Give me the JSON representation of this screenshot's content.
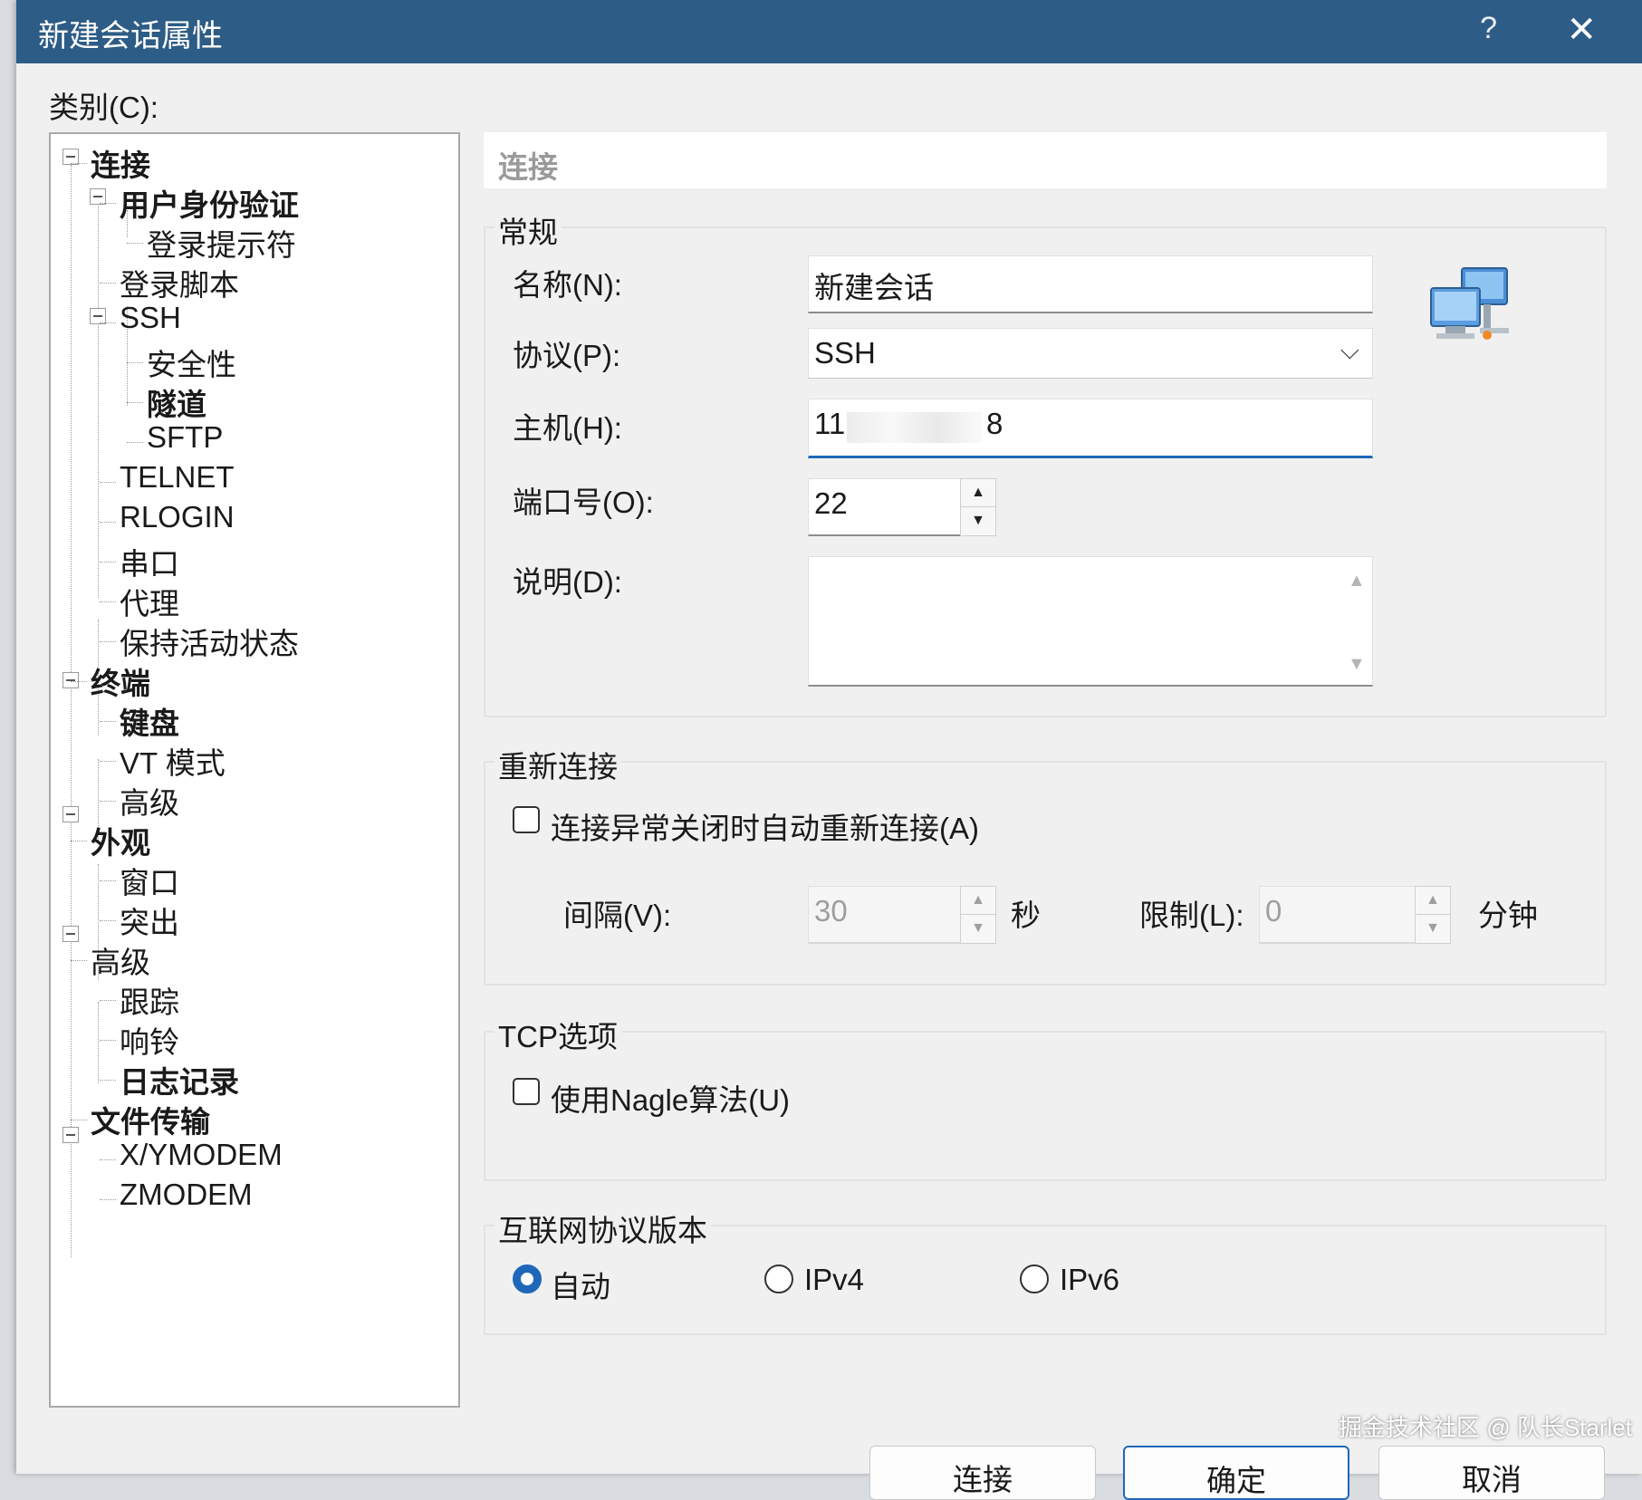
{
  "window": {
    "title": "新建会话属性",
    "help_glyph": "?",
    "close_glyph": "✕"
  },
  "category_label": "类别(C):",
  "tree": {
    "nodes": [
      {
        "label": "连接",
        "bold": true
      },
      {
        "label": "用户身份验证",
        "bold": true
      },
      {
        "label": "登录提示符",
        "bold": false
      },
      {
        "label": "登录脚本",
        "bold": false
      },
      {
        "label": "SSH",
        "bold": false
      },
      {
        "label": "安全性",
        "bold": false
      },
      {
        "label": "隧道",
        "bold": true
      },
      {
        "label": "SFTP",
        "bold": false
      },
      {
        "label": "TELNET",
        "bold": false
      },
      {
        "label": "RLOGIN",
        "bold": false
      },
      {
        "label": "串口",
        "bold": false
      },
      {
        "label": "代理",
        "bold": false
      },
      {
        "label": "保持活动状态",
        "bold": false
      },
      {
        "label": "终端",
        "bold": true
      },
      {
        "label": "键盘",
        "bold": true
      },
      {
        "label": "VT 模式",
        "bold": false
      },
      {
        "label": "高级",
        "bold": false
      },
      {
        "label": "外观",
        "bold": true
      },
      {
        "label": "窗口",
        "bold": false
      },
      {
        "label": "突出",
        "bold": false
      },
      {
        "label": "高级",
        "bold": false
      },
      {
        "label": "跟踪",
        "bold": false
      },
      {
        "label": "响铃",
        "bold": false
      },
      {
        "label": "日志记录",
        "bold": true
      },
      {
        "label": "文件传输",
        "bold": true
      },
      {
        "label": "X/YMODEM",
        "bold": false
      },
      {
        "label": "ZMODEM",
        "bold": false
      }
    ]
  },
  "section_header": "连接",
  "general": {
    "title": "常规",
    "name_label": "名称(N):",
    "name_value": "新建会话",
    "protocol_label": "协议(P):",
    "protocol_value": "SSH",
    "host_label": "主机(H):",
    "host_value_start": "11",
    "host_value_end": "8",
    "port_label": "端口号(O):",
    "port_value": "22",
    "desc_label": "说明(D):",
    "desc_value": ""
  },
  "reconnect": {
    "title": "重新连接",
    "auto_label": "连接异常关闭时自动重新连接(A)",
    "auto_checked": false,
    "interval_label": "间隔(V):",
    "interval_value": "30",
    "interval_unit": "秒",
    "limit_label": "限制(L):",
    "limit_value": "0",
    "limit_unit": "分钟"
  },
  "tcp": {
    "title": "TCP选项",
    "nagle_label": "使用Nagle算法(U)",
    "nagle_checked": false
  },
  "ip_version": {
    "title": "互联网协议版本",
    "options": [
      "自动",
      "IPv4",
      "IPv6"
    ],
    "selected": "自动"
  },
  "buttons": {
    "connect": "连接",
    "ok": "确定",
    "cancel": "取消"
  },
  "watermark": "掘金技术社区 @ 队长Starlet",
  "colors": {
    "titlebar": "#2d5c86",
    "accent": "#1f67b8",
    "dialog_bg": "#f0f0f0"
  },
  "icons": {
    "network": "network-computers-icon",
    "dropdown": "chevron-down-icon"
  }
}
